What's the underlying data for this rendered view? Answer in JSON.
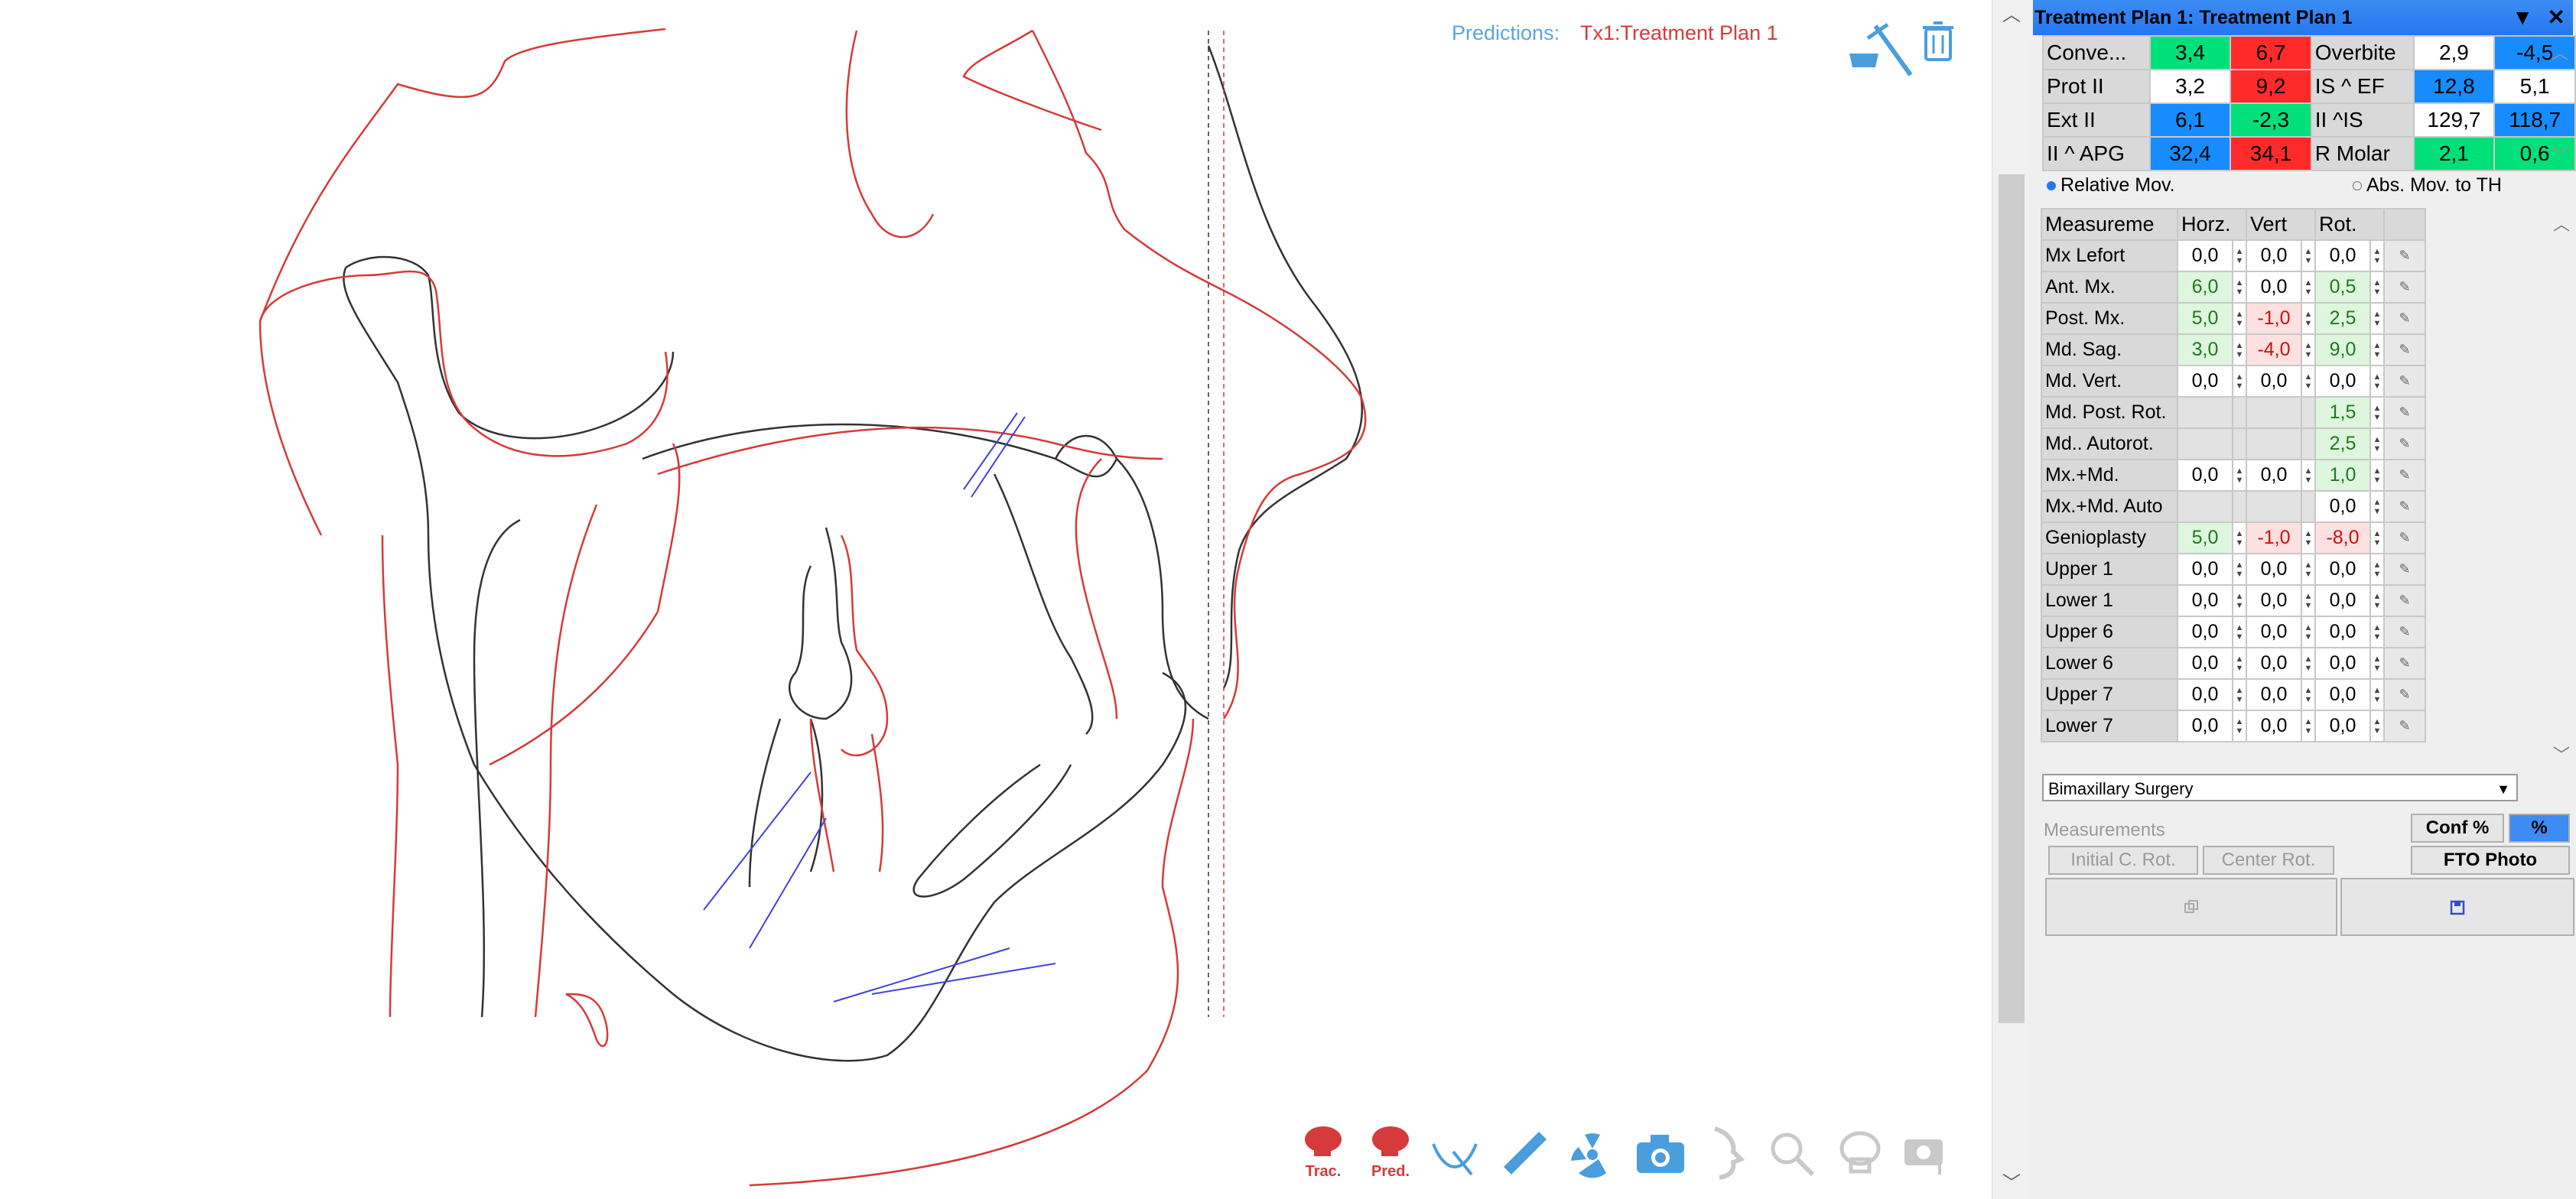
{
  "predictions": {
    "label": "Predictions:",
    "value": "Tx1:Treatment Plan 1"
  },
  "toolbar_bottom": [
    {
      "label": "Trac.",
      "icon": "skull-trace-icon"
    },
    {
      "label": "Pred.",
      "icon": "skull-prediction-icon"
    },
    {
      "label": "",
      "icon": "curve-tool-icon"
    },
    {
      "label": "",
      "icon": "ruler-icon"
    },
    {
      "label": "",
      "icon": "radiation-icon"
    },
    {
      "label": "",
      "icon": "camera-icon"
    },
    {
      "label": "",
      "icon": "profile-icon"
    },
    {
      "label": "",
      "icon": "xray-search-icon"
    },
    {
      "label": "",
      "icon": "xray-skull-icon"
    },
    {
      "label": "",
      "icon": "camera-disabled-icon"
    }
  ],
  "panel": {
    "title": "Treatment Plan 1: Treatment Plan 1",
    "summary": [
      [
        {
          "t": "Conve...",
          "c": "lab"
        },
        {
          "t": "3,4",
          "c": "g"
        },
        {
          "t": "6,7",
          "c": "r"
        },
        {
          "t": "Overbite",
          "c": "lab"
        },
        {
          "t": "2,9",
          "c": "w"
        },
        {
          "t": "-4,5",
          "c": "b"
        }
      ],
      [
        {
          "t": "Prot II",
          "c": "lab"
        },
        {
          "t": "3,2",
          "c": "w"
        },
        {
          "t": "9,2",
          "c": "r"
        },
        {
          "t": "IS ^ EF",
          "c": "lab"
        },
        {
          "t": "12,8",
          "c": "b"
        },
        {
          "t": "5,1",
          "c": "w"
        }
      ],
      [
        {
          "t": "Ext II",
          "c": "lab"
        },
        {
          "t": "6,1",
          "c": "b"
        },
        {
          "t": "-2,3",
          "c": "g"
        },
        {
          "t": "II ^IS",
          "c": "lab"
        },
        {
          "t": "129,7",
          "c": "w"
        },
        {
          "t": "118,7",
          "c": "b"
        }
      ],
      [
        {
          "t": "II ^ APG",
          "c": "lab"
        },
        {
          "t": "32,4",
          "c": "b"
        },
        {
          "t": "34,1",
          "c": "r"
        },
        {
          "t": "R Molar",
          "c": "lab"
        },
        {
          "t": "2,1",
          "c": "g"
        },
        {
          "t": "0,6",
          "c": "g"
        }
      ]
    ],
    "radio_relative": "Relative Mov.",
    "radio_absolute": "Abs. Mov. to TH",
    "columns": [
      "Measureme",
      "Horz.",
      "Vert",
      "Rot."
    ],
    "rows": [
      {
        "name": "Mx Lefort",
        "h": "0,0",
        "v": "0,0",
        "r": "0,0",
        "hs": "",
        "vs": "",
        "rs": ""
      },
      {
        "name": "Ant. Mx.",
        "h": "6,0",
        "v": "0,0",
        "r": "0,5",
        "hs": "pg",
        "vs": "",
        "rs": "pg"
      },
      {
        "name": "Post. Mx.",
        "h": "5,0",
        "v": "-1,0",
        "r": "2,5",
        "hs": "pg",
        "vs": "pr",
        "rs": "pg"
      },
      {
        "name": "Md. Sag.",
        "h": "3,0",
        "v": "-4,0",
        "r": "9,0",
        "hs": "pg",
        "vs": "pr",
        "rs": "pg"
      },
      {
        "name": "Md. Vert.",
        "h": "0,0",
        "v": "0,0",
        "r": "0,0",
        "hs": "",
        "vs": "",
        "rs": ""
      },
      {
        "name": "Md. Post. Rot.",
        "h": "",
        "v": "",
        "r": "1,5",
        "hs": "dis",
        "vs": "dis",
        "rs": "pg"
      },
      {
        "name": "Md.. Autorot.",
        "h": "",
        "v": "",
        "r": "2,5",
        "hs": "dis",
        "vs": "dis",
        "rs": "pg"
      },
      {
        "name": "Mx.+Md.",
        "h": "0,0",
        "v": "0,0",
        "r": "1,0",
        "hs": "",
        "vs": "",
        "rs": "pg"
      },
      {
        "name": "Mx.+Md. Auto",
        "h": "",
        "v": "",
        "r": "0,0",
        "hs": "dis",
        "vs": "dis",
        "rs": ""
      },
      {
        "name": "Genioplasty",
        "h": "5,0",
        "v": "-1,0",
        "r": "-8,0",
        "hs": "pg",
        "vs": "pr",
        "rs": "pr"
      },
      {
        "name": "Upper 1",
        "h": "0,0",
        "v": "0,0",
        "r": "0,0",
        "hs": "",
        "vs": "",
        "rs": ""
      },
      {
        "name": "Lower 1",
        "h": "0,0",
        "v": "0,0",
        "r": "0,0",
        "hs": "",
        "vs": "",
        "rs": ""
      },
      {
        "name": "Upper 6",
        "h": "0,0",
        "v": "0,0",
        "r": "0,0",
        "hs": "",
        "vs": "",
        "rs": ""
      },
      {
        "name": "Lower 6",
        "h": "0,0",
        "v": "0,0",
        "r": "0,0",
        "hs": "",
        "vs": "",
        "rs": ""
      },
      {
        "name": "Upper 7",
        "h": "0,0",
        "v": "0,0",
        "r": "0,0",
        "hs": "",
        "vs": "",
        "rs": ""
      },
      {
        "name": "Lower 7",
        "h": "0,0",
        "v": "0,0",
        "r": "0,0",
        "hs": "",
        "vs": "",
        "rs": ""
      }
    ],
    "surgery_select": "Bimaxillary Surgery",
    "measurements_label": "Measurements",
    "btn_conf": "Conf %",
    "btn_pct": "%",
    "btn_initial": "Initial C. Rot.",
    "btn_center": "Center Rot.",
    "btn_fto": "FTO Photo"
  },
  "colors": {
    "accent_blue": "#2577f0",
    "pred_red": "#d63a3a",
    "icon_blue": "#4a9ede"
  }
}
